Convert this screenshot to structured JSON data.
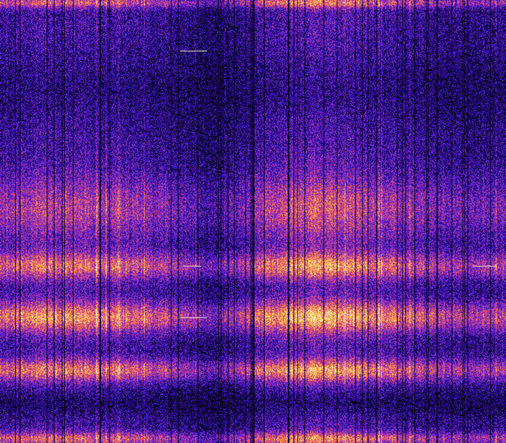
{
  "image": {
    "kind": "spectrogram-waterfall",
    "palette": [
      "#000000",
      "#1a0060",
      "#3a1bd0",
      "#8a2cc8",
      "#e0407a",
      "#ff8a3c",
      "#ffe850",
      "#ffffff"
    ],
    "background": "#000000",
    "bands": [
      {
        "center": 0.005,
        "spread": 0.012,
        "strength": 0.75
      },
      {
        "center": 0.47,
        "spread": 0.07,
        "strength": 0.55
      },
      {
        "center": 0.6,
        "spread": 0.03,
        "strength": 0.85
      },
      {
        "center": 0.715,
        "spread": 0.035,
        "strength": 1.0
      },
      {
        "center": 0.835,
        "spread": 0.025,
        "strength": 0.9
      },
      {
        "center": 0.99,
        "spread": 0.015,
        "strength": 0.8
      }
    ]
  }
}
